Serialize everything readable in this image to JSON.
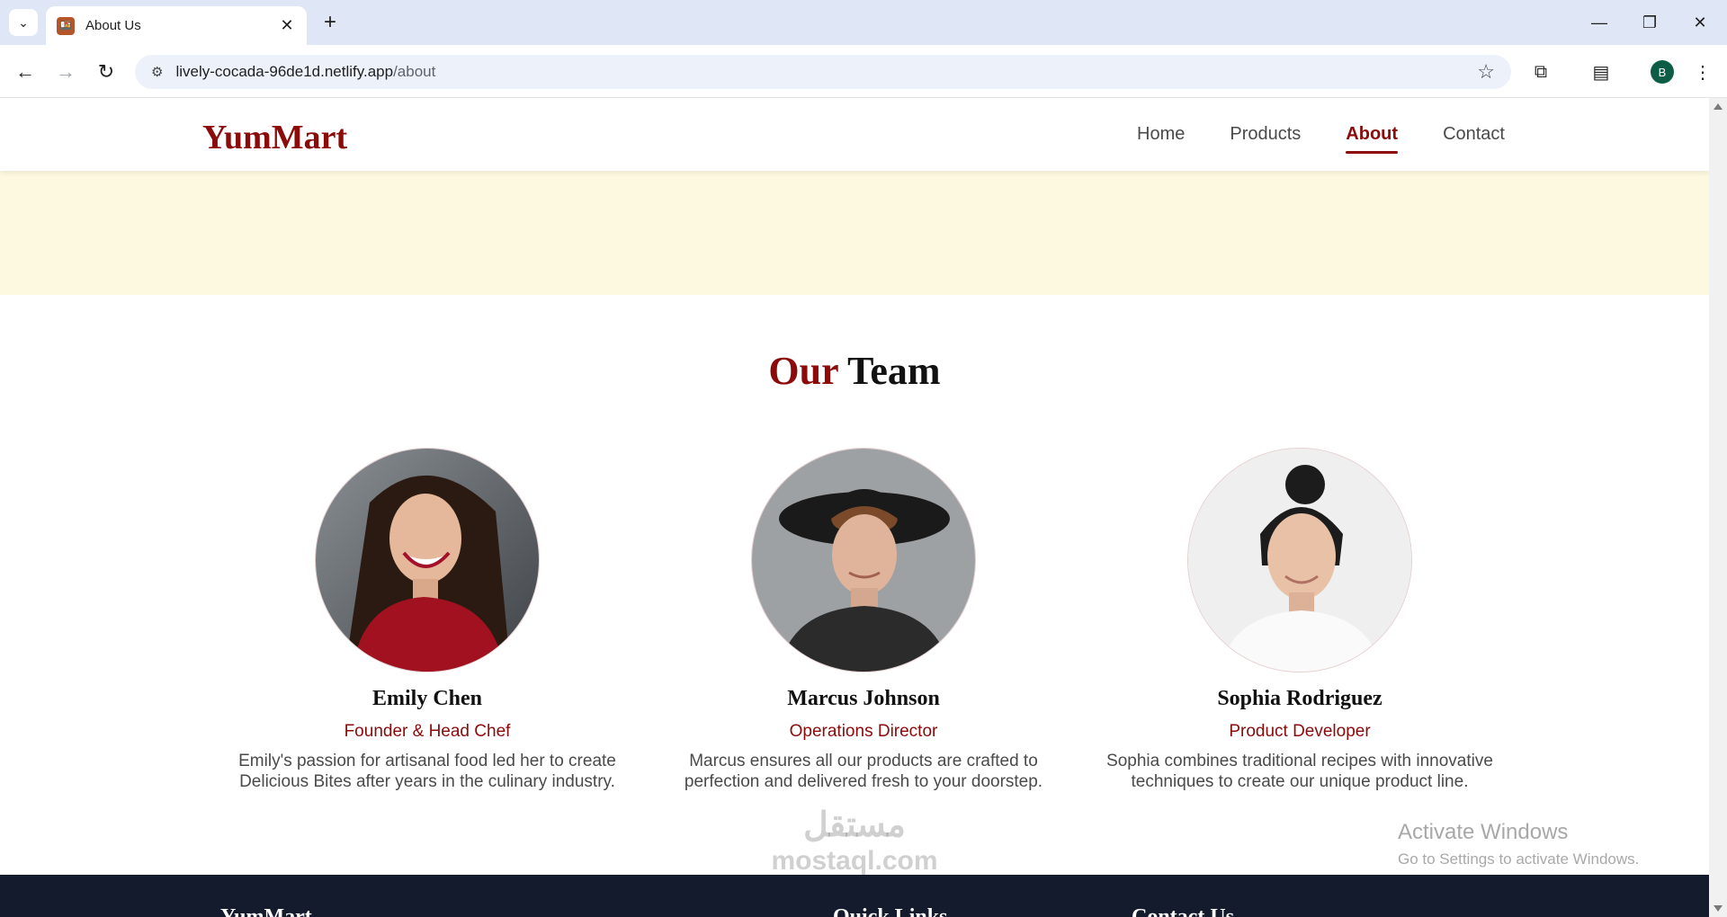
{
  "browser": {
    "tab_title": "About Us",
    "url_host": "lively-cocada-96de1d.netlify.app",
    "url_path": "/about",
    "profile_initial": "B"
  },
  "site": {
    "logo": "YumMart",
    "nav": [
      {
        "label": "Home",
        "active": false
      },
      {
        "label": "Products",
        "active": false
      },
      {
        "label": "About",
        "active": true
      },
      {
        "label": "Contact",
        "active": false
      }
    ],
    "accent_color": "#8b0a0a",
    "hero_band_color": "#fdf8e0",
    "footer_color": "#141b2d"
  },
  "team": {
    "title_accent": "Our",
    "title_rest": "Team",
    "members": [
      {
        "name": "Emily Chen",
        "role": "Founder & Head Chef",
        "bio": "Emily's passion for artisanal food led her to create Delicious Bites after years in the culinary industry."
      },
      {
        "name": "Marcus Johnson",
        "role": "Operations Director",
        "bio": "Marcus ensures all our products are crafted to perfection and delivered fresh to your doorstep."
      },
      {
        "name": "Sophia Rodriguez",
        "role": "Product Developer",
        "bio": "Sophia combines traditional recipes with innovative techniques to create our unique product line."
      }
    ]
  },
  "footer": {
    "col1": "YumMart",
    "col2": "Quick Links",
    "col3": "Contact Us"
  },
  "overlay": {
    "watermark_arabic": "مستقل",
    "watermark_latin": "mostaql.com",
    "activate_title": "Activate Windows",
    "activate_sub": "Go to Settings to activate Windows."
  }
}
